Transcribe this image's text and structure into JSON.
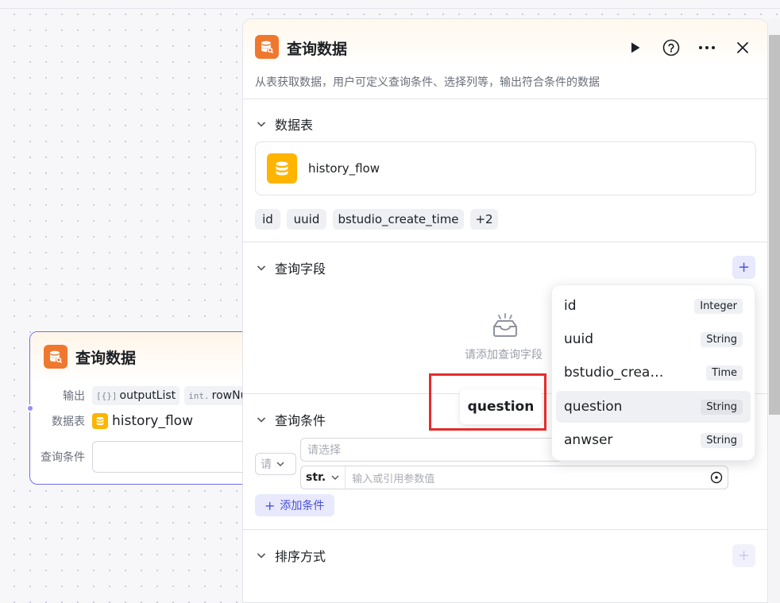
{
  "canvas_node": {
    "title": "查询数据",
    "output_label": "输出",
    "outputs": [
      {
        "prefix": "[{}]",
        "name": "outputList"
      },
      {
        "prefix": "int.",
        "name": "rowNu"
      }
    ],
    "table_label": "数据表",
    "table_name": "history_flow",
    "condition_label": "查询条件"
  },
  "panel": {
    "title": "查询数据",
    "description": "从表获取数据，用户可定义查询条件、选择列等，输出符合条件的数据",
    "sections": {
      "table": {
        "title": "数据表",
        "table_name": "history_flow",
        "fields": [
          "id",
          "uuid",
          "bstudio_create_time",
          "+2"
        ]
      },
      "query_fields": {
        "title": "查询字段",
        "empty_text": "请添加查询字段"
      },
      "conditions": {
        "title": "查询条件",
        "logic_select": "请",
        "field_placeholder": "请选择",
        "value_type": "str.",
        "value_placeholder": "输入或引用参数值",
        "add_label": "添加条件"
      },
      "sort": {
        "title": "排序方式"
      }
    }
  },
  "dropdown": {
    "items": [
      {
        "name": "id",
        "type": "Integer"
      },
      {
        "name": "uuid",
        "type": "String"
      },
      {
        "name": "bstudio_crea…",
        "type": "Time"
      },
      {
        "name": "question",
        "type": "String"
      },
      {
        "name": "anwser",
        "type": "String"
      }
    ]
  },
  "drag_ghost": "question",
  "colors": {
    "accent": "#5156e0",
    "brand_orange": "#f0782e",
    "table_yellow": "#ffb400",
    "highlight_red": "#e52b2b"
  }
}
